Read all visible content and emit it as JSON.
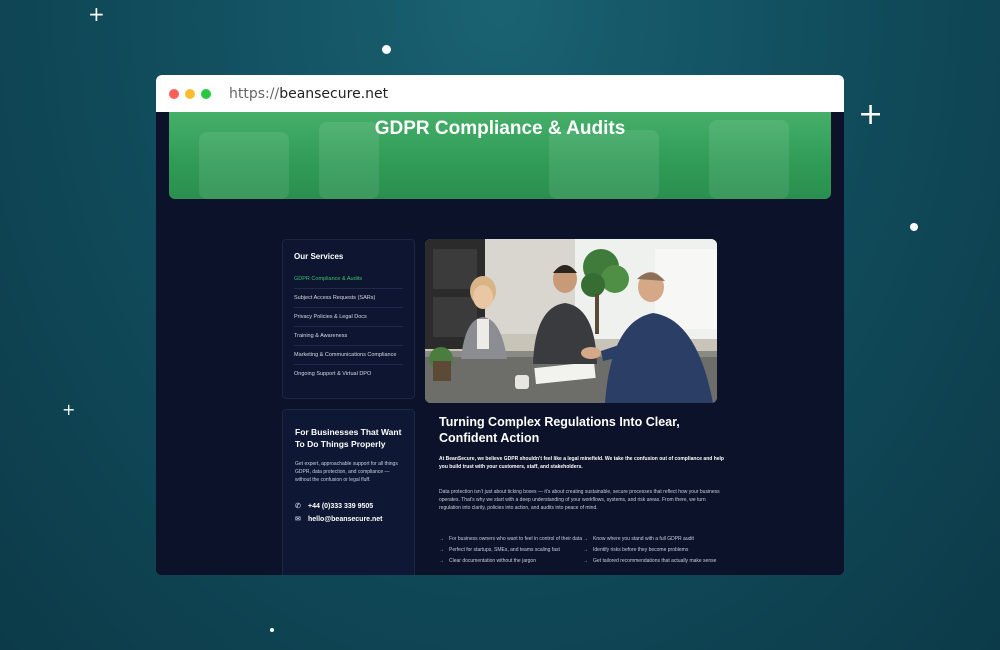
{
  "browser": {
    "url_protocol": "https://",
    "url_domain": "beansecure.net",
    "traffic_lights": [
      "#ff5f57",
      "#febc2e",
      "#28c840"
    ]
  },
  "hero": {
    "title": "GDPR Compliance & Audits"
  },
  "sidebar": {
    "heading": "Our Services",
    "items": [
      {
        "label": "GDPR Compliance & Audits",
        "active": true
      },
      {
        "label": "Subject Access Requests (SARs)"
      },
      {
        "label": "Privacy Policies & Legal Docs"
      },
      {
        "label": "Training & Awareness"
      },
      {
        "label": "Marketing & Communications Compliance"
      },
      {
        "label": "Ongoing Support & Virtual DPO"
      }
    ]
  },
  "contact": {
    "heading": "For Businesses That Want To Do Things Properly",
    "text": "Get expert, approachable support for all things GDPR, data protection, and compliance — without the confusion or legal fluff.",
    "phone": "+44 (0)333 339 9505",
    "email": "hello@beansecure.net"
  },
  "main": {
    "heading": "Turning Complex Regulations Into Clear, Confident Action",
    "intro": "At BeanSecure, we believe GDPR shouldn’t feel like a legal minefield. We take the confusion out of compliance and help you build trust with your customers, staff, and stakeholders.",
    "body": "Data protection isn’t just about ticking boxes — it’s about creating sustainable, secure processes that reflect how your business operates. That’s why we start with a deep understanding of your workflows, systems, and risk areas. From there, we turn regulation into clarity, policies into action, and audits into peace of mind.",
    "bullets_left": [
      "For business owners who want to feel in control of their data",
      "Perfect for startups, SMEs, and teams scaling fast",
      "Clear documentation without the jargon"
    ],
    "bullets_right": [
      "Know where you stand with a full GDPR audit",
      "Identify risks before they become problems",
      "Get tailored recommendations that actually make sense"
    ]
  },
  "colors": {
    "accent_green": "#3fbf6a",
    "hero_green": "#2f9b56",
    "page_navy": "#0b1229",
    "background_teal": "#114e5e"
  }
}
